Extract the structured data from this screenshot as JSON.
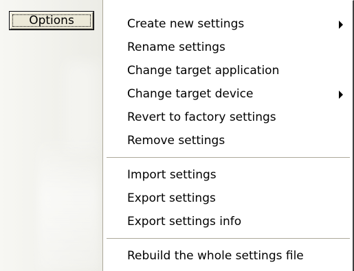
{
  "button": {
    "label": "Options"
  },
  "menu": {
    "groups": [
      [
        {
          "label": "Create new settings",
          "submenu": true,
          "arrow_icon": "submenu-arrow-icon"
        },
        {
          "label": "Rename settings",
          "submenu": false
        },
        {
          "label": "Change target application",
          "submenu": false
        },
        {
          "label": "Change target device",
          "submenu": true,
          "arrow_icon": "submenu-arrow-icon"
        },
        {
          "label": "Revert to factory settings",
          "submenu": false
        },
        {
          "label": "Remove settings",
          "submenu": false
        }
      ],
      [
        {
          "label": "Import settings",
          "submenu": false
        },
        {
          "label": "Export settings",
          "submenu": false
        },
        {
          "label": "Export settings info",
          "submenu": false
        }
      ],
      [
        {
          "label": "Rebuild the whole settings file",
          "submenu": false
        }
      ]
    ]
  },
  "colors": {
    "button_face": "#ece9d8",
    "menu_background": "#ffffff",
    "separator": "#aca899",
    "text": "#000000"
  }
}
